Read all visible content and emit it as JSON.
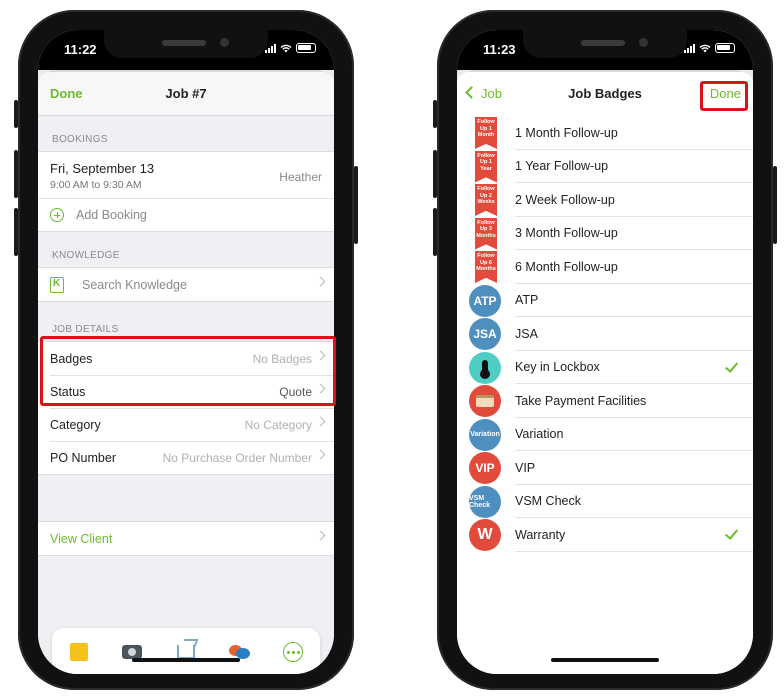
{
  "left_phone": {
    "status_time": "11:22",
    "nav": {
      "done_label": "Done",
      "title": "Job #7"
    },
    "bookings": {
      "header": "BOOKINGS",
      "item": {
        "date": "Fri, September 13",
        "time": "9:00 AM to 9:30 AM",
        "assignee": "Heather"
      },
      "add_label": "Add Booking"
    },
    "knowledge": {
      "header": "KNOWLEDGE",
      "search_label": "Search Knowledge"
    },
    "job_details": {
      "header": "JOB DETAILS",
      "rows": [
        {
          "label": "Badges",
          "value": "No Badges"
        },
        {
          "label": "Status",
          "value": "Quote"
        },
        {
          "label": "Category",
          "value": "No Category"
        },
        {
          "label": "PO Number",
          "value": "No Purchase Order Number"
        }
      ]
    },
    "view_client_label": "View Client",
    "toolbar_icons": [
      "note-icon",
      "camera-icon",
      "share-icon",
      "chat-icon",
      "more-icon"
    ]
  },
  "right_phone": {
    "status_time": "11:23",
    "nav": {
      "back_label": "Job",
      "title": "Job Badges",
      "done_label": "Done"
    },
    "badges": [
      {
        "label": "1 Month Follow-up",
        "icon_text": "Follow Up 1 Month",
        "style": "ribbon",
        "checked": false
      },
      {
        "label": "1 Year Follow-up",
        "icon_text": "Follow Up 1 Year",
        "style": "ribbon",
        "checked": false
      },
      {
        "label": "2 Week Follow-up",
        "icon_text": "Follow Up 2 Weeks",
        "style": "ribbon",
        "checked": false
      },
      {
        "label": "3 Month Follow-up",
        "icon_text": "Follow Up 3 Months",
        "style": "ribbon",
        "checked": false
      },
      {
        "label": "6 Month Follow-up",
        "icon_text": "Follow Up 6 Months",
        "style": "ribbon",
        "checked": false
      },
      {
        "label": "ATP",
        "icon_text": "ATP",
        "style": "blue",
        "checked": false
      },
      {
        "label": "JSA",
        "icon_text": "JSA",
        "style": "blue",
        "checked": false
      },
      {
        "label": "Key in Lockbox",
        "icon_text": "",
        "style": "teal",
        "checked": true
      },
      {
        "label": "Take Payment Facilities",
        "icon_text": "",
        "style": "red-card",
        "checked": false
      },
      {
        "label": "Variation",
        "icon_text": "Variation",
        "style": "blue-small",
        "checked": false
      },
      {
        "label": "VIP",
        "icon_text": "VIP",
        "style": "red",
        "checked": false
      },
      {
        "label": "VSM Check",
        "icon_text": "VSM Check",
        "style": "blue-small",
        "checked": false
      },
      {
        "label": "Warranty",
        "icon_text": "W",
        "style": "red",
        "checked": true
      }
    ]
  },
  "colors": {
    "accent_green": "#6dbb2f",
    "highlight_red": "#d9131a",
    "badge_red": "#e24a3c",
    "badge_blue": "#4f8fc0",
    "badge_teal": "#4ecdc4"
  }
}
